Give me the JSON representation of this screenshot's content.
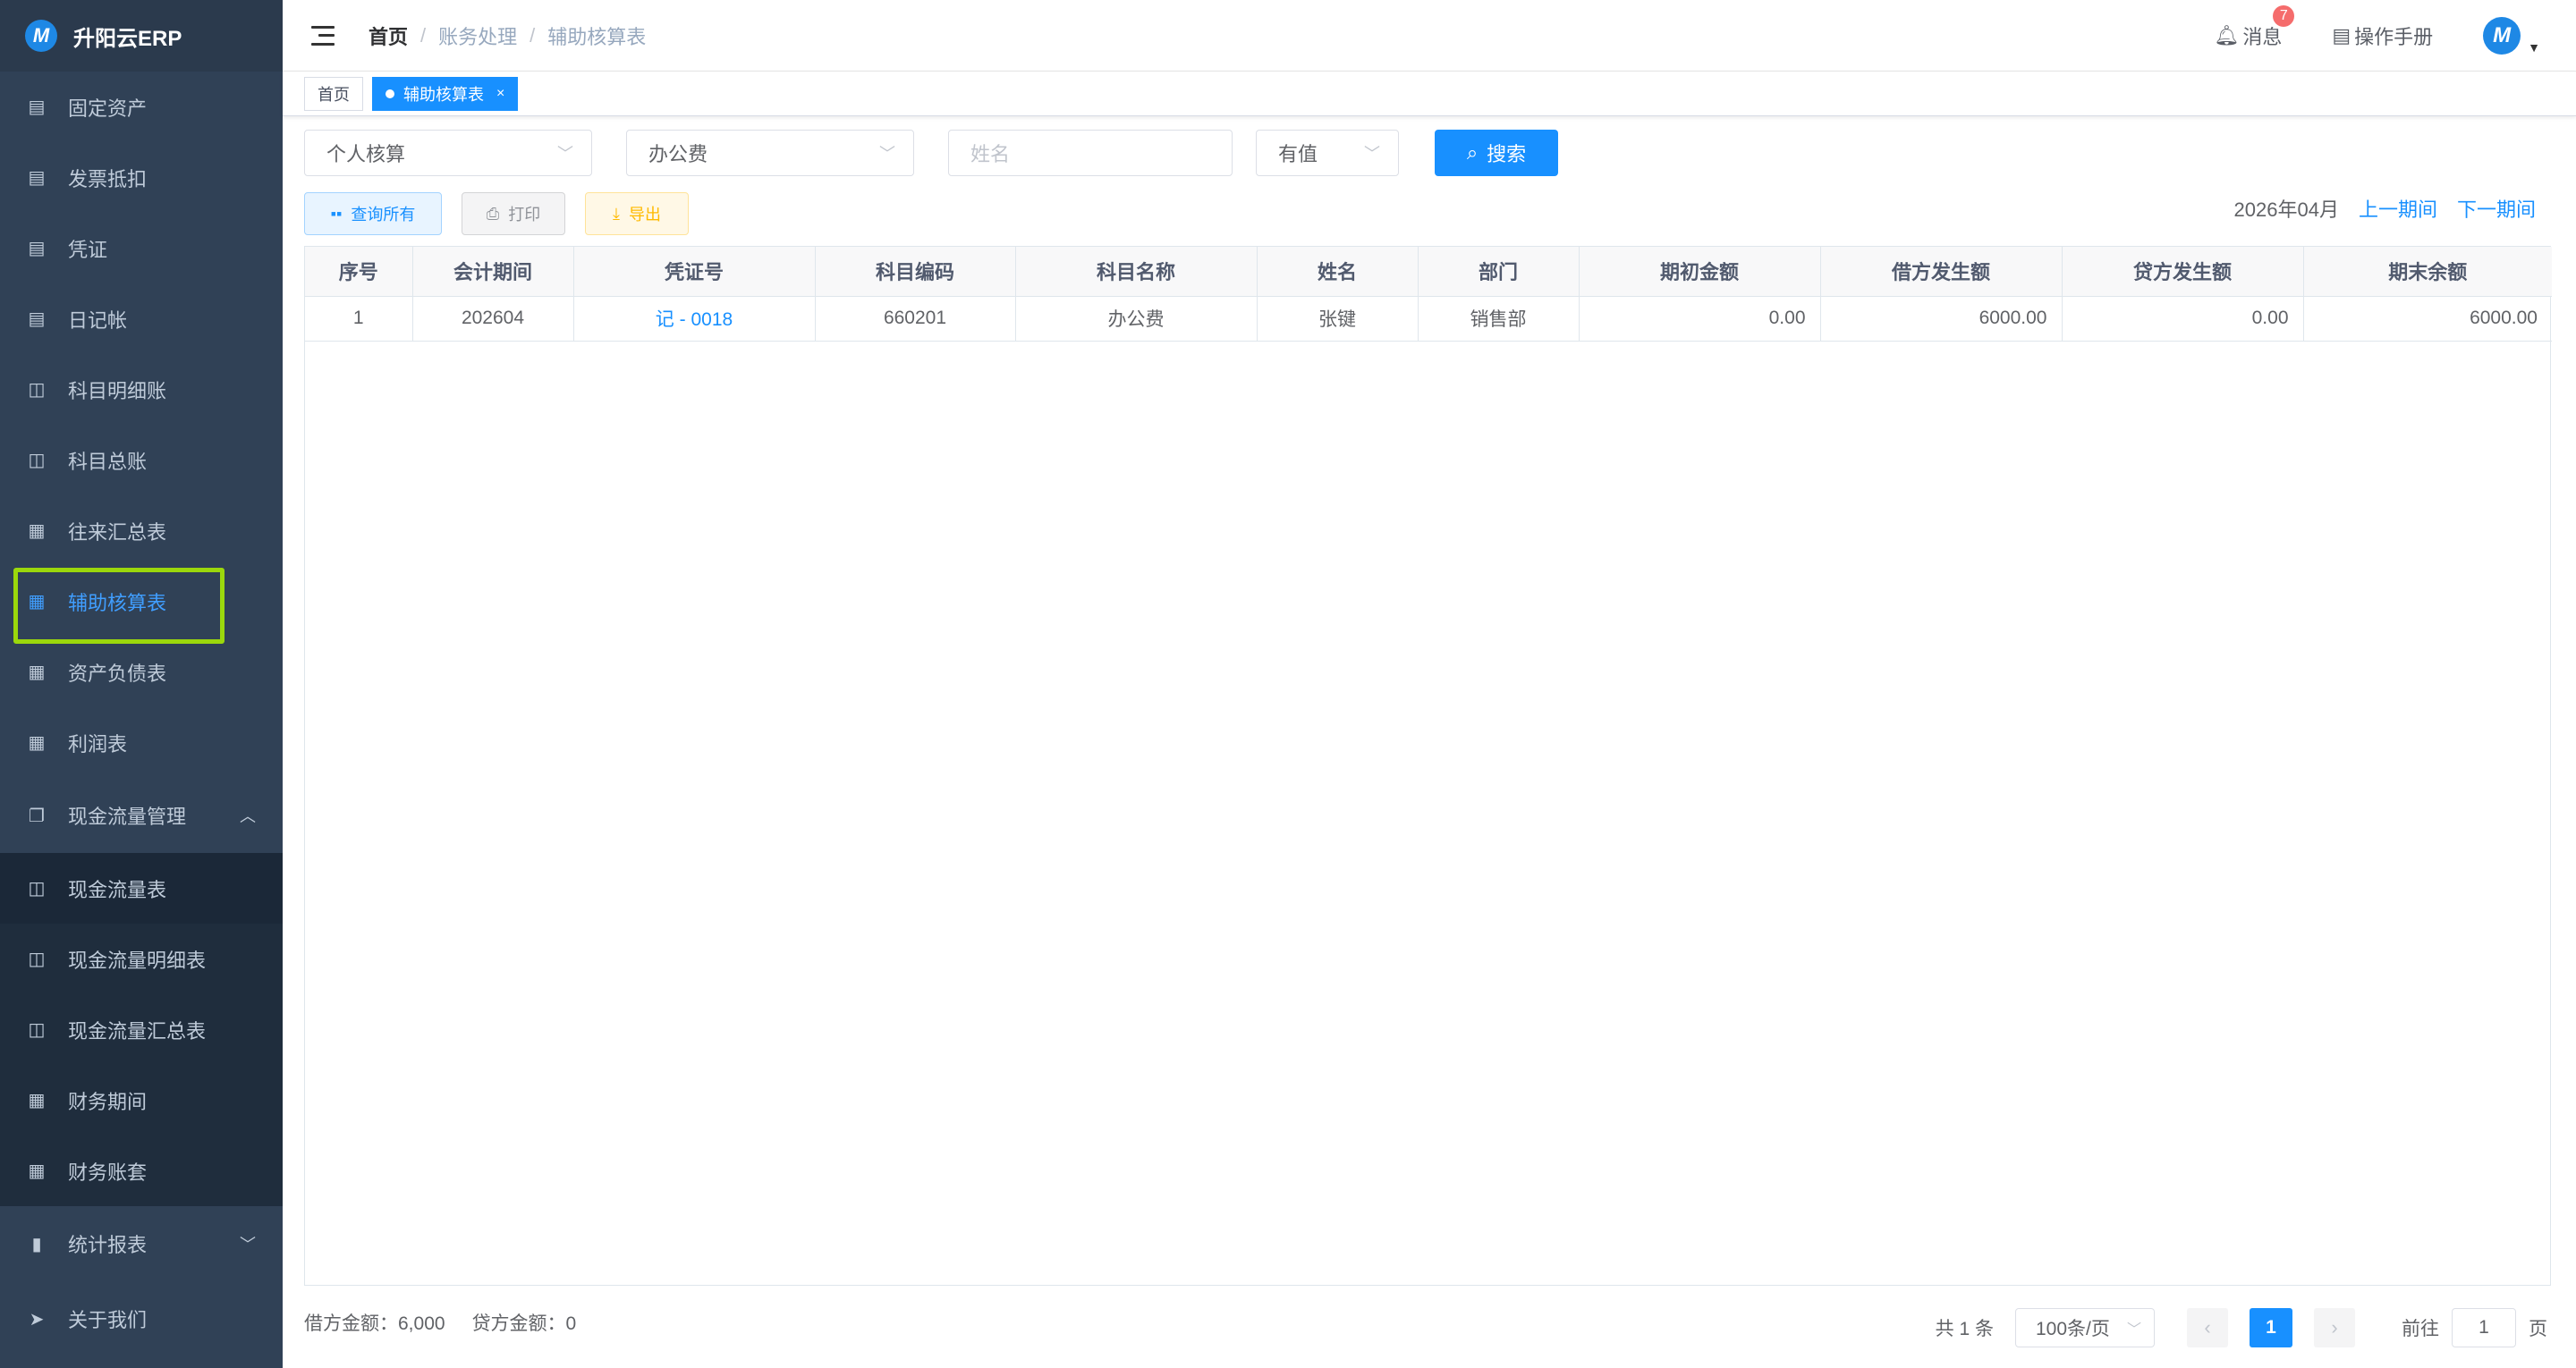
{
  "app": {
    "name": "升阳云ERP",
    "logo_letter": "M"
  },
  "sidebar": {
    "items": [
      {
        "label": "固定资产",
        "icon": "document-icon"
      },
      {
        "label": "发票抵扣",
        "icon": "document-icon"
      },
      {
        "label": "凭证",
        "icon": "document-icon"
      },
      {
        "label": "日记帐",
        "icon": "document-icon"
      },
      {
        "label": "科目明细账",
        "icon": "book-icon"
      },
      {
        "label": "科目总账",
        "icon": "book-icon"
      },
      {
        "label": "往来汇总表",
        "icon": "table-icon"
      },
      {
        "label": "辅助核算表",
        "icon": "table-icon",
        "active": true
      },
      {
        "label": "资产负债表",
        "icon": "table-icon"
      },
      {
        "label": "利润表",
        "icon": "table-icon"
      }
    ],
    "cashflow_group": {
      "label": "现金流量管理",
      "icon": "copy-icon",
      "expanded": true
    },
    "cashflow_items": [
      {
        "label": "现金流量表",
        "icon": "book-icon"
      },
      {
        "label": "现金流量明细表",
        "icon": "book-icon"
      },
      {
        "label": "现金流量汇总表",
        "icon": "book-icon"
      },
      {
        "label": "财务期间",
        "icon": "table-icon"
      },
      {
        "label": "财务账套",
        "icon": "table-icon"
      }
    ],
    "stats_group": {
      "label": "统计报表",
      "icon": "bar-chart-icon",
      "expanded": false
    },
    "about": {
      "label": "关于我们",
      "icon": "send-icon"
    }
  },
  "header": {
    "breadcrumb": [
      "首页",
      "账务处理",
      "辅助核算表"
    ],
    "messages_label": "消息",
    "messages_count": "7",
    "manual_label": "操作手册",
    "avatar_letter": "M"
  },
  "tags": [
    {
      "label": "首页",
      "active": false
    },
    {
      "label": "辅助核算表",
      "active": true,
      "close": "×"
    }
  ],
  "filters": {
    "type_value": "个人核算",
    "subject_value": "办公费",
    "name_placeholder": "姓名",
    "value_filter": "有值",
    "search_label": "搜索"
  },
  "actions": {
    "query_all": "查询所有",
    "print": "打印",
    "export": "导出"
  },
  "period": {
    "current": "2026年04月",
    "prev": "上一期间",
    "next": "下一期间"
  },
  "table": {
    "columns": [
      "序号",
      "会计期间",
      "凭证号",
      "科目编码",
      "科目名称",
      "姓名",
      "部门",
      "期初金额",
      "借方发生额",
      "贷方发生额",
      "期末余额"
    ],
    "rows": [
      {
        "index": "1",
        "period": "202604",
        "voucher": "记 - 0018",
        "code": "660201",
        "subject": "办公费",
        "name": "张键",
        "dept": "销售部",
        "opening": "0.00",
        "debit": "6000.00",
        "credit": "0.00",
        "closing": "6000.00"
      }
    ]
  },
  "footer": {
    "debit_total": "借方金额：6,000",
    "credit_total": "贷方金额：0",
    "total": "共 1 条",
    "page_size": "100条/页",
    "current_page": "1",
    "goto_label": "前往",
    "goto_value": "1",
    "page_suffix": "页"
  },
  "colors": {
    "sidebar": "#304156",
    "accent": "#1890ff",
    "highlight": "#9bd80c"
  }
}
